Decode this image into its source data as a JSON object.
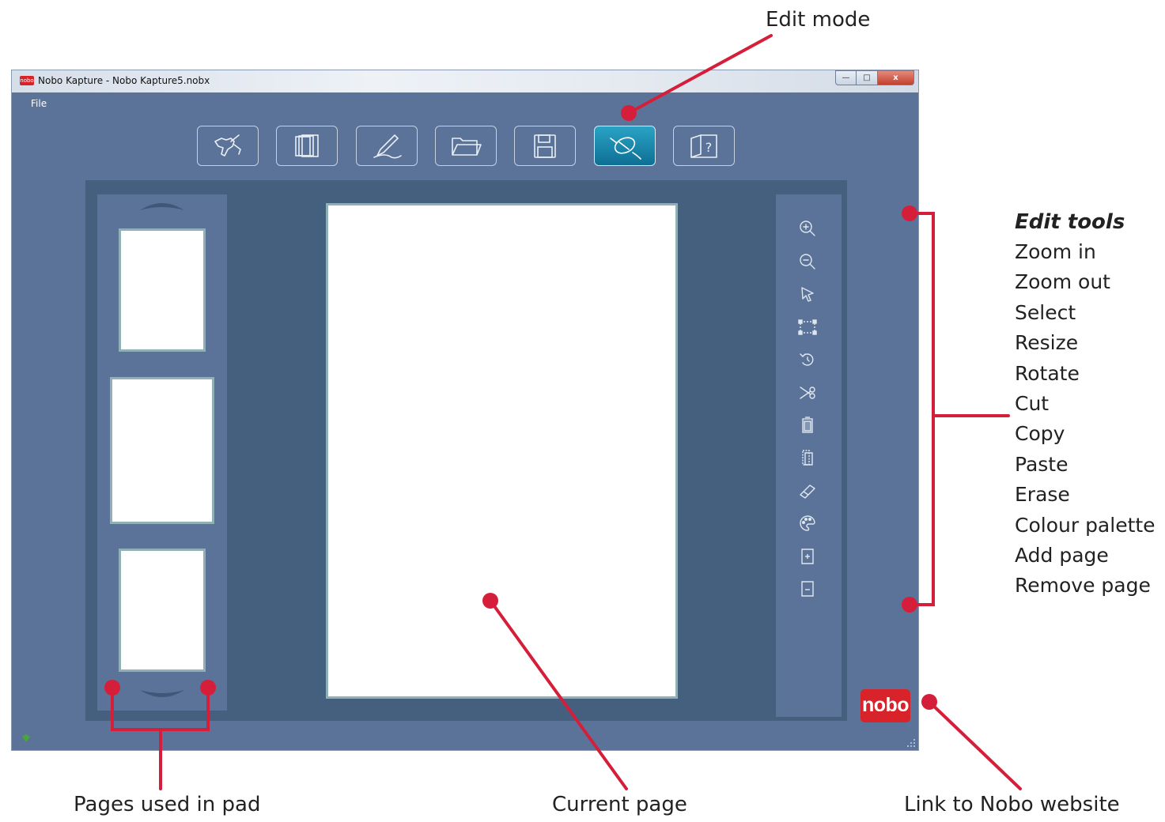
{
  "window": {
    "title": "Nobo Kapture - Nobo Kapture5.nobx",
    "logo_text": "nobo",
    "minimize": "—",
    "maximize": "□",
    "close": "x"
  },
  "menu": {
    "file": "File"
  },
  "toolbar": {
    "active": "edit-mode",
    "buttons": [
      {
        "id": "capture",
        "icon": "hand-pen-icon"
      },
      {
        "id": "pages",
        "icon": "pages-stack-icon"
      },
      {
        "id": "pen",
        "icon": "pen-icon"
      },
      {
        "id": "open",
        "icon": "folder-icon"
      },
      {
        "id": "save",
        "icon": "floppy-disk-icon"
      },
      {
        "id": "edit-mode",
        "icon": "mouse-icon"
      },
      {
        "id": "help",
        "icon": "help-book-icon"
      }
    ]
  },
  "edit_tools": {
    "title": "Edit tools",
    "items": [
      "Zoom in",
      "Zoom out",
      "Select",
      "Resize",
      "Rotate",
      "Cut",
      "Copy",
      "Paste",
      "Erase",
      "Colour palette",
      "Add page",
      "Remove page"
    ]
  },
  "annotations": {
    "edit_mode": "Edit mode",
    "pages_used": "Pages used in pad",
    "current_page": "Current page",
    "link_to_website": "Link to Nobo website"
  },
  "brand": {
    "logo_text": "nobo",
    "accent": "#d8232a",
    "window_bg": "#5b7399",
    "workspace_bg": "#44607e",
    "callout_color": "#d51f3a"
  }
}
